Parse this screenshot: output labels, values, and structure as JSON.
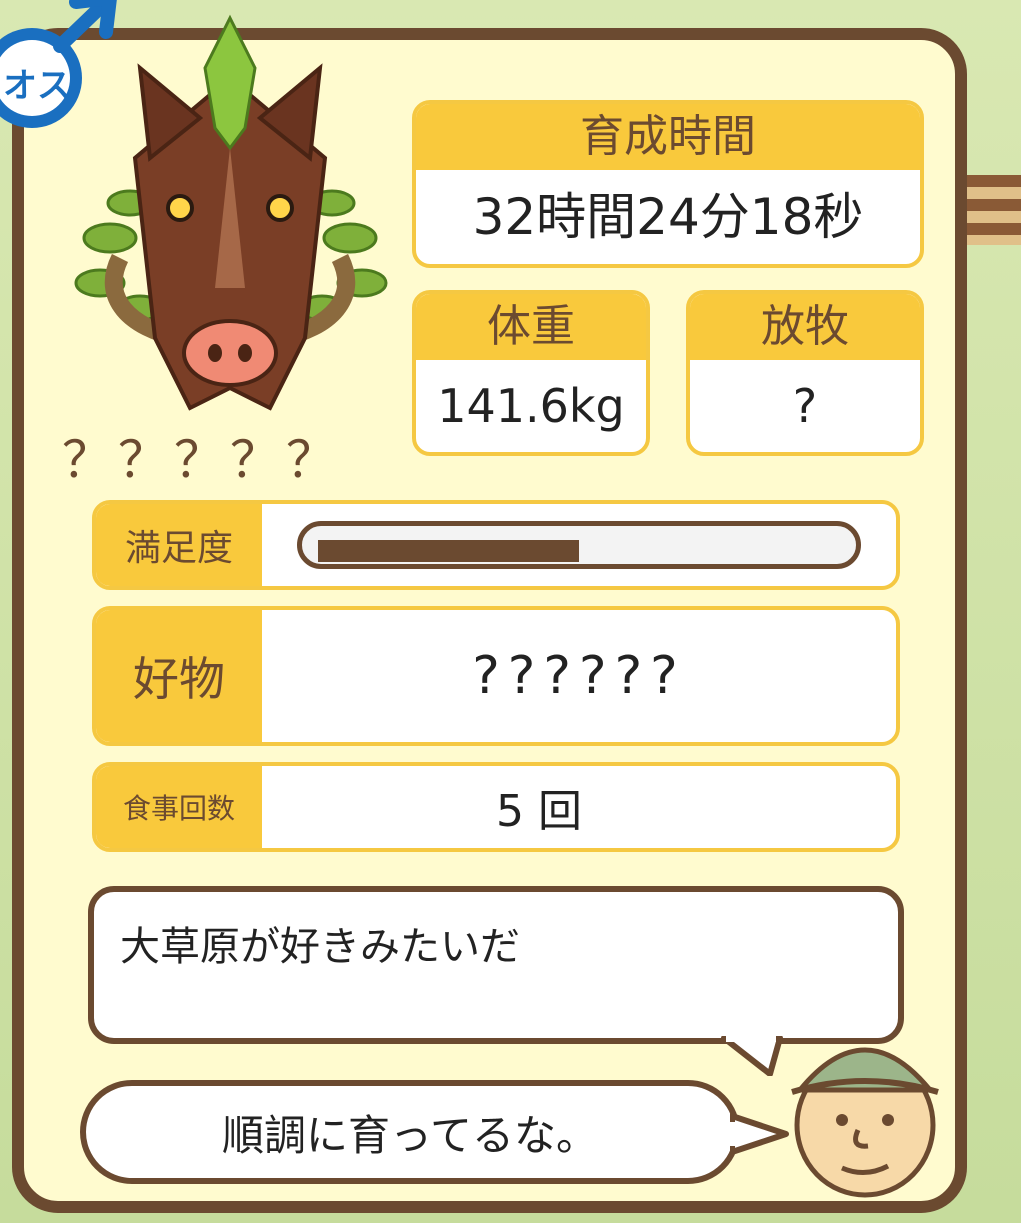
{
  "gender_badge": {
    "label": "オス"
  },
  "boar": {
    "name": "？？？？？",
    "icon": "boar-portrait"
  },
  "stats": {
    "growth_time": {
      "label": "育成時間",
      "value": "32時間24分18秒"
    },
    "weight": {
      "label": "体重",
      "value": "141.6kg"
    },
    "grazing": {
      "label": "放牧",
      "value": "?"
    }
  },
  "rows": {
    "satisfaction": {
      "label": "満足度",
      "level": 0.5
    },
    "favorite": {
      "label": "好物",
      "value": "??????"
    },
    "meals": {
      "label": "食事回数",
      "value": "5 回"
    }
  },
  "message": {
    "text": "大草原が好きみたいだ"
  },
  "farmer": {
    "comment": "順調に育ってるな。",
    "icon": "farmer-face"
  },
  "colors": {
    "panel_bg": "#fffbcf",
    "border": "#6b4a30",
    "accent": "#f9c93c",
    "badge": "#1a6fc0"
  }
}
